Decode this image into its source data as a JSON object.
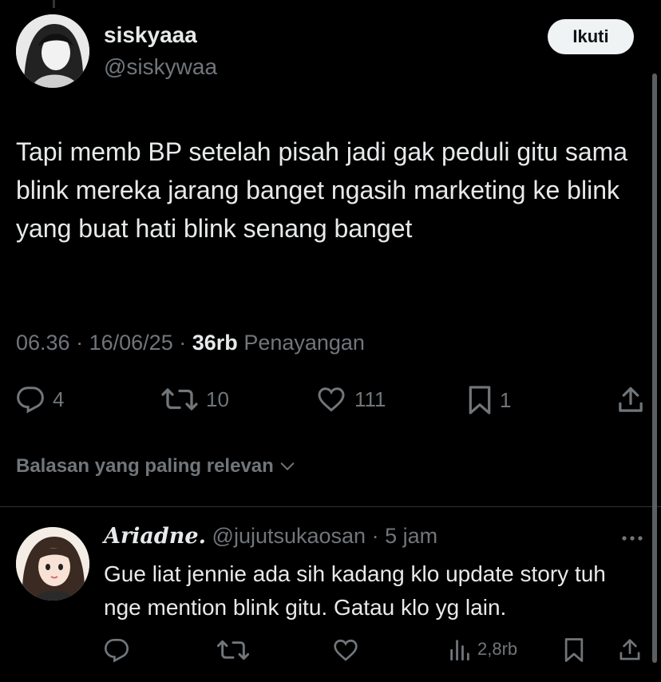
{
  "post": {
    "display_name": "siskyaaa",
    "handle": "@siskywaa",
    "follow_label": "Ikuti",
    "text": "Tapi memb BP setelah pisah jadi gak peduli gitu sama blink mereka jarang banget ngasih marketing ke blink yang buat hati blink senang banget",
    "time": "06.36",
    "sep1": "·",
    "date": "16/06/25",
    "sep2": "·",
    "views_count": "36rb",
    "views_label": "Penayangan",
    "actions": {
      "replies": "4",
      "reposts": "10",
      "likes": "111",
      "bookmarks": "1"
    }
  },
  "sort": {
    "label": "Balasan yang paling relevan"
  },
  "reply": {
    "display_name": "Ariadne.",
    "handle": "@jujutsukaosan",
    "sep": "·",
    "time": "5 jam",
    "text": "Gue liat jennie ada sih kadang klo update story tuh nge mention blink gitu. Gatau klo yg lain.",
    "views": "2,8rb"
  },
  "colors": {
    "background": "#000000",
    "text": "#e7e9ea",
    "muted": "#71767b",
    "divider": "#2f3336",
    "button_bg": "#eff3f4"
  },
  "icons": [
    "reply-icon",
    "repost-icon",
    "like-icon",
    "bookmark-icon",
    "share-icon",
    "views-icon",
    "more-icon",
    "chevron-down-icon"
  ]
}
